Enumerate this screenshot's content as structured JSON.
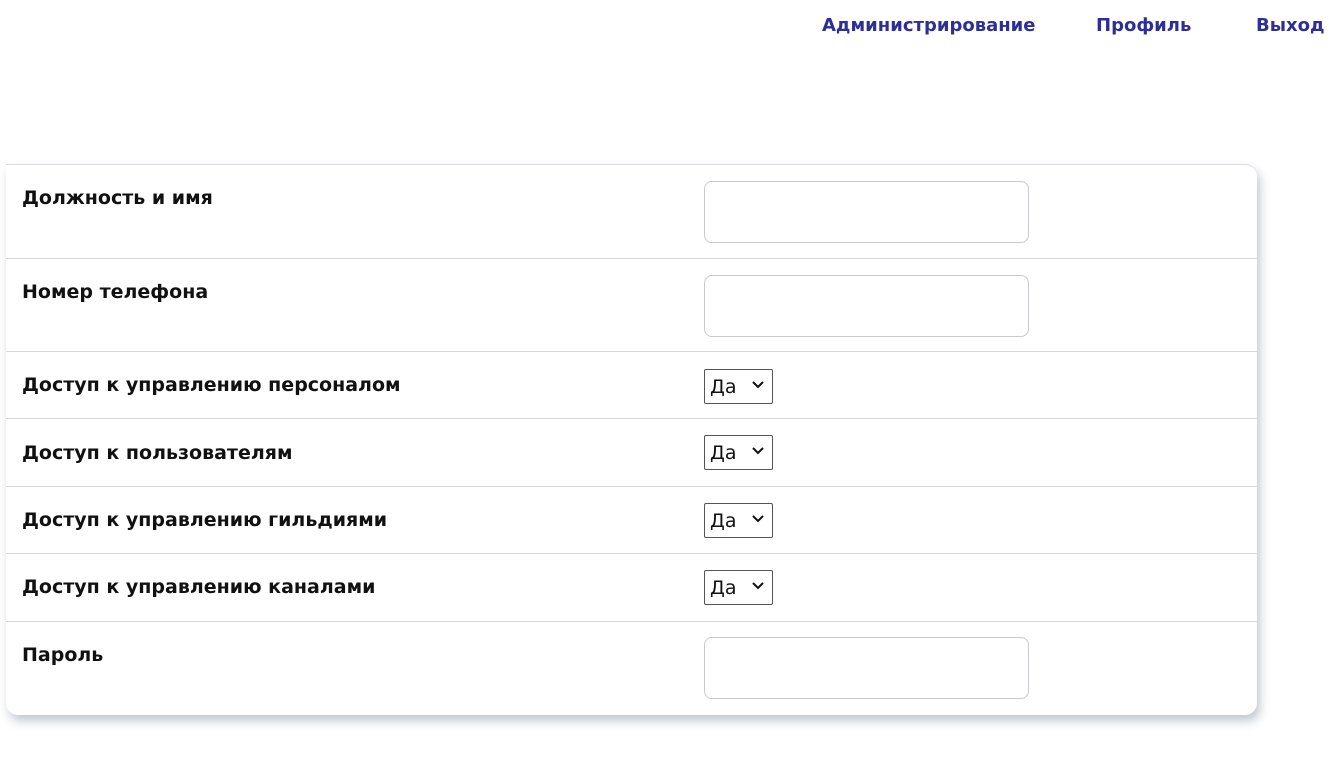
{
  "nav": {
    "admin": "Администрирование",
    "profile": "Профиль",
    "exit": "Выход",
    "link_color": "#2e2f96"
  },
  "form": {
    "fields": [
      {
        "label": "Должность и имя",
        "type": "text",
        "value": ""
      },
      {
        "label": "Номер телефона",
        "type": "text",
        "value": ""
      },
      {
        "label": "Доступ к управлению персоналом",
        "type": "select",
        "value": "Да"
      },
      {
        "label": "Доступ к пользователям",
        "type": "select",
        "value": "Да"
      },
      {
        "label": "Доступ к управлению гильдиями",
        "type": "select",
        "value": "Да"
      },
      {
        "label": "Доступ к управлению каналами",
        "type": "select",
        "value": "Да"
      },
      {
        "label": "Пароль",
        "type": "text",
        "value": ""
      }
    ]
  },
  "icons": {
    "select_arrow": "chevron-down-icon"
  }
}
